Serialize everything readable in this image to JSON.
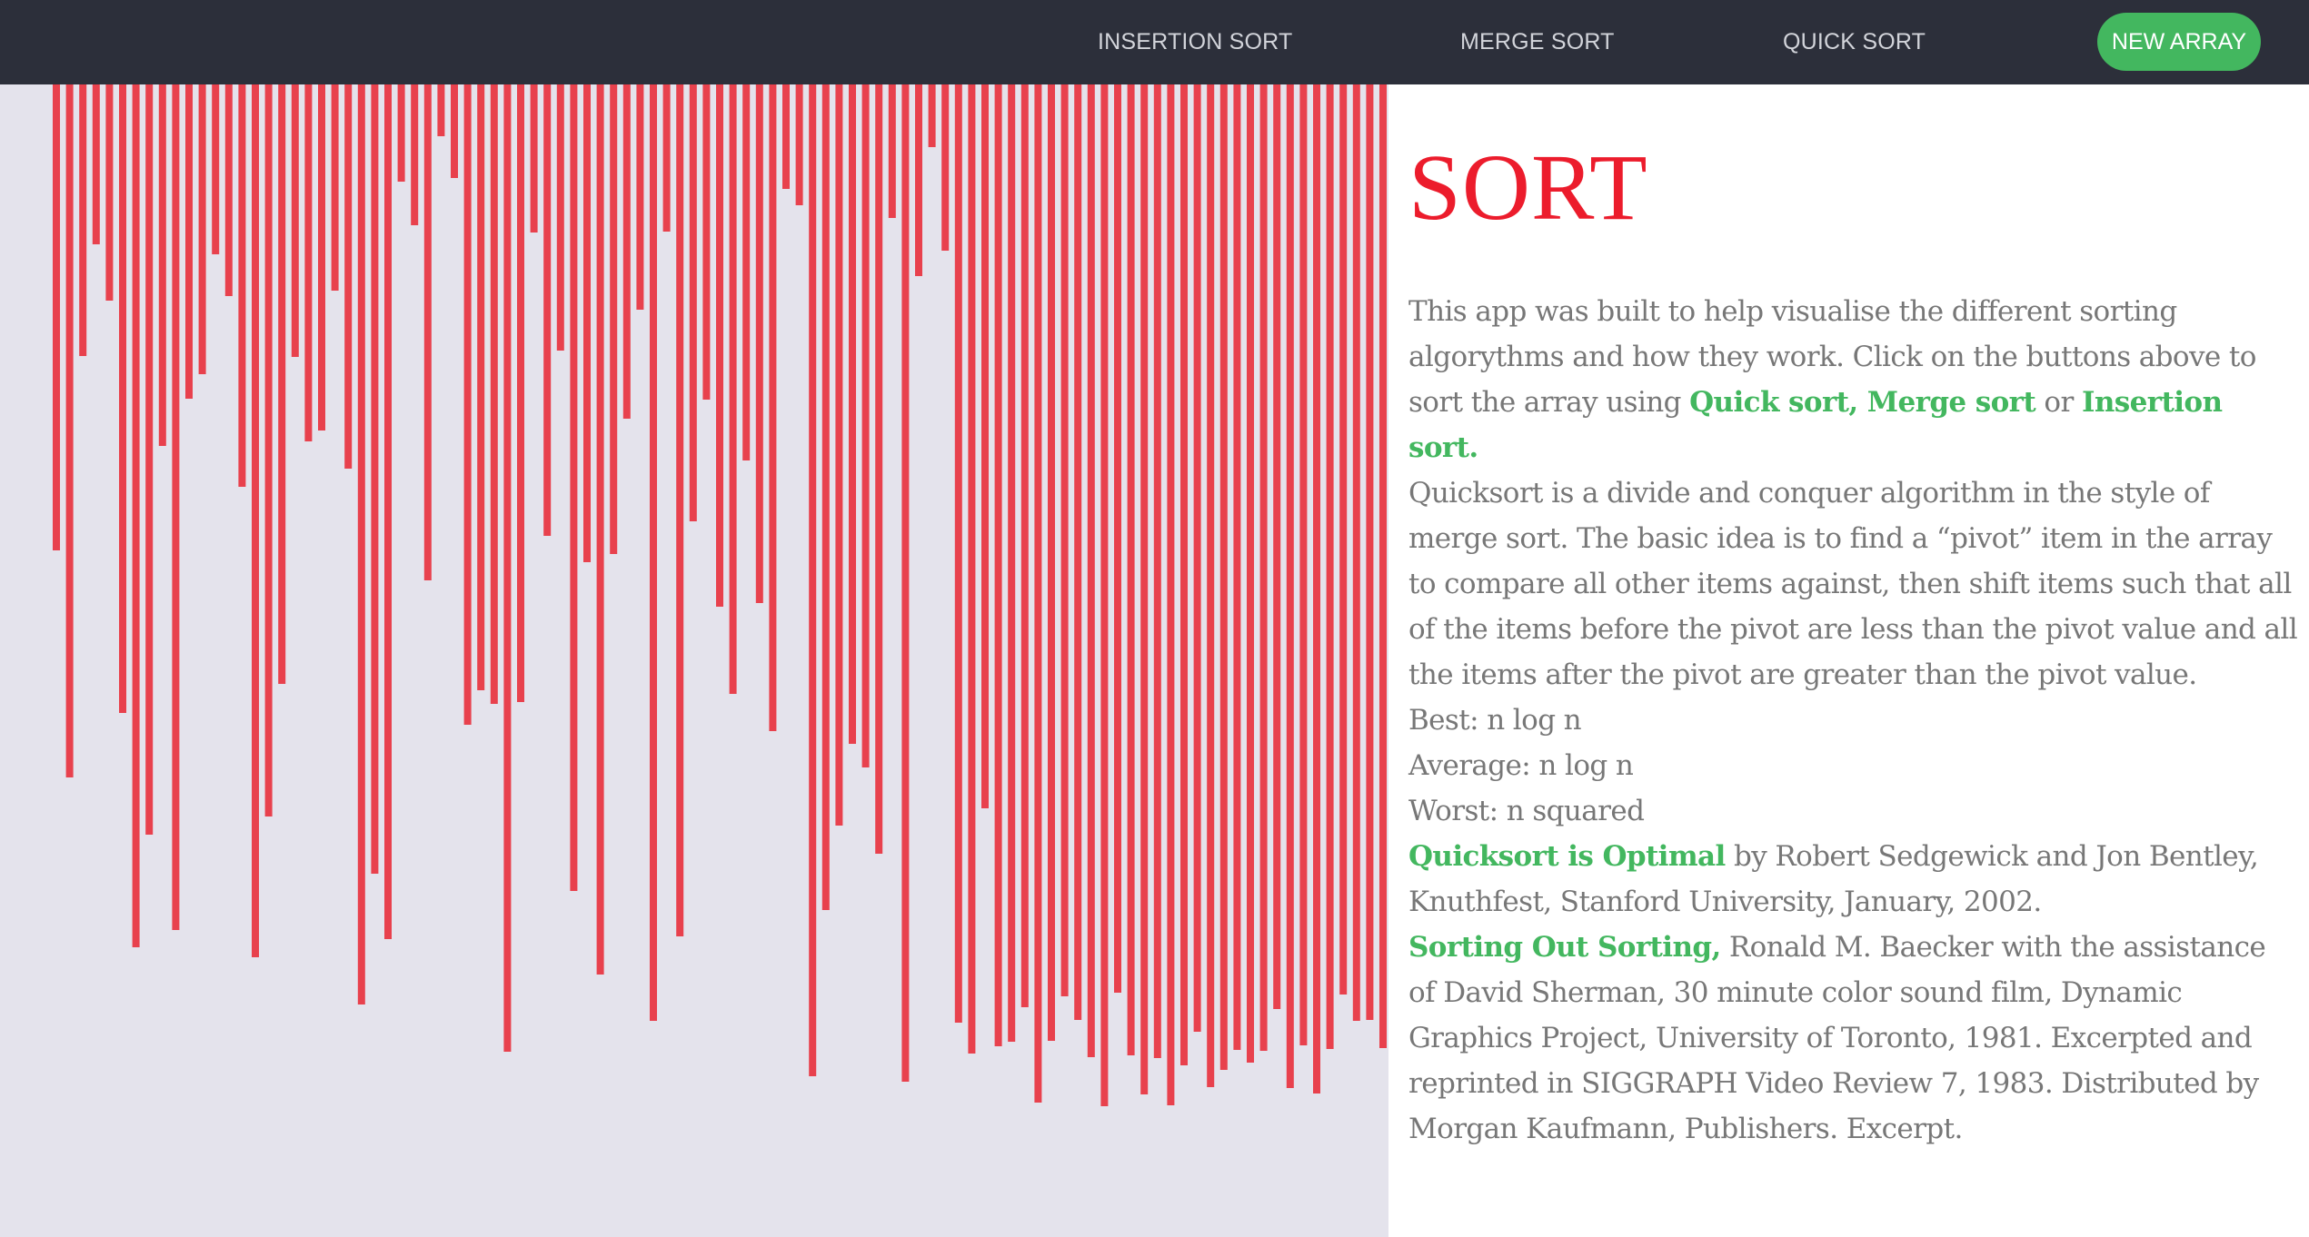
{
  "nav": {
    "insertion_sort": "INSERTION SORT",
    "merge_sort": "MERGE SORT",
    "quick_sort": "QUICK SORT",
    "new_array": "NEW ARRAY"
  },
  "colors": {
    "navbar": "#2c2f3a",
    "bar": "#e8414d",
    "panel": "#e4e3ec",
    "accent_green": "#43b75f",
    "title_red": "#ec1c2c"
  },
  "array": {
    "max_value": 1269,
    "values": [
      513,
      763,
      299,
      176,
      238,
      692,
      950,
      826,
      398,
      931,
      346,
      319,
      187,
      233,
      443,
      961,
      806,
      660,
      300,
      393,
      381,
      227,
      423,
      1013,
      869,
      941,
      107,
      155,
      546,
      57,
      103,
      705,
      667,
      682,
      1065,
      680,
      163,
      497,
      293,
      888,
      526,
      980,
      517,
      368,
      248,
      1031,
      162,
      938,
      481,
      347,
      575,
      671,
      414,
      571,
      712,
      115,
      133,
      1092,
      909,
      816,
      726,
      752,
      847,
      147,
      1098,
      211,
      69,
      183,
      1033,
      1067,
      797,
      1059,
      1054,
      1016,
      1121,
      1053,
      1004,
      1030,
      1071,
      1125,
      1000,
      1069,
      1112,
      1072,
      1124,
      1080,
      1043,
      1104,
      1085,
      1063,
      1077,
      1064,
      1018,
      1105,
      1058,
      1111,
      1062,
      1002,
      1031,
      1030,
      1061,
      1090,
      1046,
      1000,
      1066,
      1026,
      1089,
      1075,
      1039,
      1007,
      1104,
      1093,
      1086,
      1068,
      1058,
      1083,
      1076,
      1069,
      1045,
      1006,
      1085,
      1071,
      1090,
      1035,
      1110,
      1081,
      1069,
      1083,
      1049,
      1112
    ]
  },
  "info": {
    "title": "SORT",
    "intro_text": "This app was built to help visualise the different sorting algorythms and how they work. Click on the buttons above to sort the array using ",
    "link_quick_merge": "Quick sort, Merge sort",
    "or_text": " or ",
    "link_insertion": "Insertion sort.",
    "quicksort_description": "Quicksort is a divide and conquer algorithm in the style of merge sort. The basic idea is to find a “pivot” item in the array to compare all other items against, then shift items such that all of the items before the pivot are less than the pivot value and all the items after the pivot are greater than the pivot value.",
    "best": "Best: n log n",
    "average": "Average: n log n",
    "worst": "Worst: n squared",
    "ref1_link": "Quicksort is Optimal",
    "ref1_text": " by Robert Sedgewick and Jon Bentley, Knuthfest, Stanford University, January, 2002.",
    "ref2_link": "Sorting Out Sorting,",
    "ref2_text": " Ronald M. Baecker with the assistance of David Sherman, 30 minute color sound film, Dynamic Graphics Project, University of Toronto, 1981. Excerpted and reprinted in SIGGRAPH Video Review 7, 1983. Distributed by Morgan Kaufmann, Publishers. Excerpt."
  }
}
